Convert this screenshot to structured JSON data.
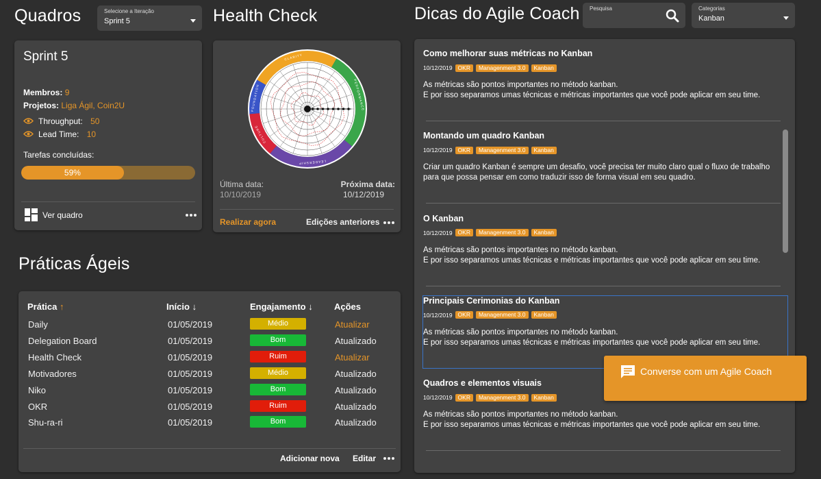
{
  "quadros": {
    "title": "Quadros",
    "iteration_select": {
      "label": "Selecione a Iteração",
      "value": "Sprint 5"
    },
    "sprint_card": {
      "name": "Sprint 5",
      "members_label": "Membros:",
      "members_value": "9",
      "projects_label": "Projetos:",
      "projects_value": "Liga Ágil, Coin2U",
      "throughput_label": "Throughput:",
      "throughput_value": "50",
      "leadtime_label": "Lead Time:",
      "leadtime_value": "10",
      "tasks_label": "Tarefas concluídas:",
      "progress_percent": 59,
      "progress_text": "59%",
      "view_board": "Ver quadro"
    }
  },
  "health_check": {
    "title": "Health Check",
    "wheel_segments": [
      "CLARITY",
      "PERFORMANCE",
      "LEADERSHIP",
      "CULTURE",
      "FOUNDATION"
    ],
    "last_date_label": "Última data:",
    "last_date": "10/10/2019",
    "next_date_label": "Próxima data:",
    "next_date": "10/12/2019",
    "do_now": "Realizar agora",
    "previous": "Edições anteriores",
    "colors": {
      "clarity": "#f0a423",
      "performance": "#3aa64a",
      "leadership": "#6a48a8",
      "culture": "#d8263a",
      "foundation": "#3a55c8"
    }
  },
  "praticas": {
    "title": "Práticas Ágeis",
    "headers": {
      "pratica": "Prática",
      "inicio": "Início",
      "engajamento": "Engajamento",
      "acoes": "Ações"
    },
    "rows": [
      {
        "pratica": "Daily",
        "inicio": "01/05/2019",
        "engajamento": "Médio",
        "level": "medio",
        "acao": "Atualizar",
        "acao_type": "link"
      },
      {
        "pratica": "Delegation Board",
        "inicio": "01/05/2019",
        "engajamento": "Bom",
        "level": "bom",
        "acao": "Atualizado",
        "acao_type": "text"
      },
      {
        "pratica": "Health Check",
        "inicio": "01/05/2019",
        "engajamento": "Ruim",
        "level": "ruim",
        "acao": "Atualizar",
        "acao_type": "link"
      },
      {
        "pratica": "Motivadores",
        "inicio": "01/05/2019",
        "engajamento": "Médio",
        "level": "medio",
        "acao": "Atualizado",
        "acao_type": "text"
      },
      {
        "pratica": "Niko",
        "inicio": "01/05/2019",
        "engajamento": "Bom",
        "level": "bom",
        "acao": "Atualizado",
        "acao_type": "text"
      },
      {
        "pratica": "OKR",
        "inicio": "01/05/2019",
        "engajamento": "Ruim",
        "level": "ruim",
        "acao": "Atualizado",
        "acao_type": "text"
      },
      {
        "pratica": "Shu-ra-ri",
        "inicio": "01/05/2019",
        "engajamento": "Bom",
        "level": "bom",
        "acao": "Atualizado",
        "acao_type": "text"
      }
    ],
    "add_new": "Adicionar nova",
    "edit": "Editar",
    "level_colors": {
      "medio": "#d4b000",
      "bom": "#18b837",
      "ruim": "#e11d0a"
    }
  },
  "dicas": {
    "title": "Dicas do Agile Coach",
    "search": {
      "label": "Pesquisa",
      "value": ""
    },
    "category_select": {
      "label": "Categorias",
      "value": "Kanban"
    },
    "tips": [
      {
        "title": "Como melhorar suas métricas no Kanban",
        "date": "10/12/2019",
        "tags": [
          "OKR",
          "Managenment 3.0",
          "Kanban"
        ],
        "desc": [
          "As métricas são pontos importantes no método kanban.",
          "E por isso separamos umas técnicas e métricas importantes que você pode aplicar em seu time."
        ]
      },
      {
        "title": "Montando um quadro Kanban",
        "date": "10/12/2019",
        "tags": [
          "OKR",
          "Managenment 3.0",
          "Kanban"
        ],
        "desc": [
          "Criar um quadro Kanban é sempre um desafio, você precisa ter muito claro qual o fluxo de trabalho para que possa pensar em como traduzir isso de forma visual em seu quadro."
        ]
      },
      {
        "title": "O Kanban",
        "date": "10/12/2019",
        "tags": [
          "OKR",
          "Managenment 3.0",
          "Kanban"
        ],
        "desc": [
          "As métricas são pontos importantes no método kanban.",
          "E por isso separamos umas técnicas e métricas importantes que você pode aplicar em seu time."
        ]
      },
      {
        "title": "Principais Cerimonias do Kanban",
        "date": "10/12/2019",
        "tags": [
          "OKR",
          "Managenment 3.0",
          "Kanban"
        ],
        "desc": [
          "As métricas são pontos importantes no método kanban.",
          "E por isso separamos umas técnicas e métricas importantes que você pode aplicar em seu time."
        ]
      },
      {
        "title": "Quadros e elementos visuais",
        "date": "10/12/2019",
        "tags": [
          "OKR",
          "Managenment 3.0",
          "Kanban"
        ],
        "desc": [
          "As métricas são pontos importantes no método kanban.",
          "E por isso separamos umas técnicas e métricas importantes que você pode aplicar em seu time."
        ]
      }
    ],
    "chat_button": "Converse com um Agile Coach"
  },
  "accent_color": "#e59528"
}
